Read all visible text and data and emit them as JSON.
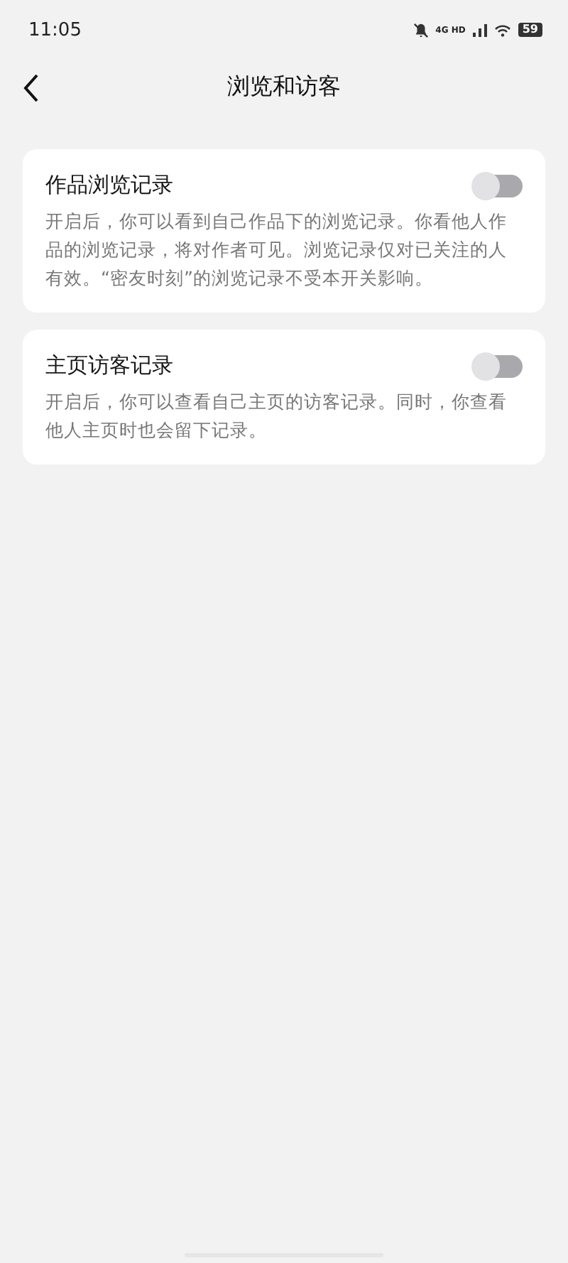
{
  "status_bar": {
    "time": "11:05",
    "network": "4G HD",
    "battery": "59"
  },
  "header": {
    "title": "浏览和访客"
  },
  "settings": [
    {
      "title": "作品浏览记录",
      "on": false,
      "description": "开启后，你可以看到自己作品下的浏览记录。你看他人作品的浏览记录，将对作者可见。浏览记录仅对已关注的人有效。“密友时刻”的浏览记录不受本开关影响。"
    },
    {
      "title": "主页访客记录",
      "on": false,
      "description": "开启后，你可以查看自己主页的访客记录。同时，你查看他人主页时也会留下记录。"
    }
  ]
}
